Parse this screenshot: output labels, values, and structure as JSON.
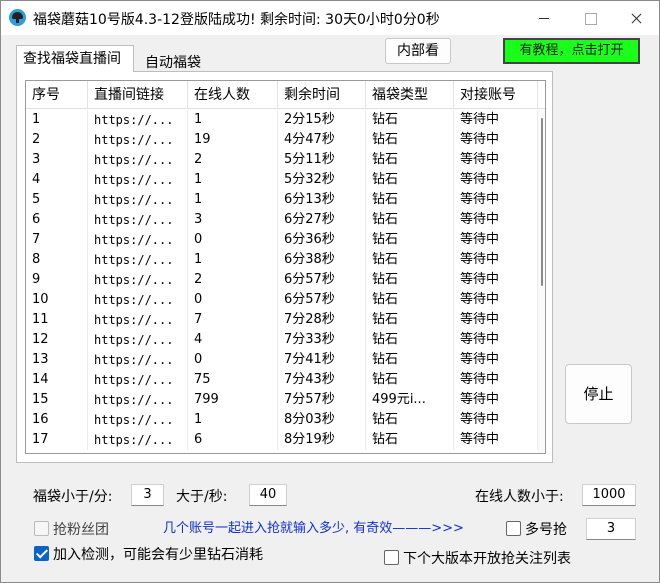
{
  "window": {
    "title": "福袋蘑菇10号版4.3-12登版陆成功! 剩余时间:  30天0小时0分0秒"
  },
  "tabs": {
    "find": "查找福袋直播间",
    "auto": "自动福袋"
  },
  "buttons": {
    "inner": "内部看",
    "tutorial": "有教程，点击打开",
    "stop": "停止"
  },
  "table": {
    "columns": [
      "序号",
      "直播间链接",
      "在线人数",
      "剩余时间",
      "福袋类型",
      "对接账号"
    ],
    "rows": [
      [
        "1",
        "https://...",
        "1",
        "2分15秒",
        "钻石",
        "等待中"
      ],
      [
        "2",
        "https://...",
        "19",
        "4分47秒",
        "钻石",
        "等待中"
      ],
      [
        "3",
        "https://...",
        "2",
        "5分11秒",
        "钻石",
        "等待中"
      ],
      [
        "4",
        "https://...",
        "1",
        "5分32秒",
        "钻石",
        "等待中"
      ],
      [
        "5",
        "https://...",
        "1",
        "6分13秒",
        "钻石",
        "等待中"
      ],
      [
        "6",
        "https://...",
        "3",
        "6分27秒",
        "钻石",
        "等待中"
      ],
      [
        "7",
        "https://...",
        "0",
        "6分36秒",
        "钻石",
        "等待中"
      ],
      [
        "8",
        "https://...",
        "1",
        "6分38秒",
        "钻石",
        "等待中"
      ],
      [
        "9",
        "https://...",
        "2",
        "6分57秒",
        "钻石",
        "等待中"
      ],
      [
        "10",
        "https://...",
        "0",
        "6分57秒",
        "钻石",
        "等待中"
      ],
      [
        "11",
        "https://...",
        "7",
        "7分28秒",
        "钻石",
        "等待中"
      ],
      [
        "12",
        "https://...",
        "4",
        "7分33秒",
        "钻石",
        "等待中"
      ],
      [
        "13",
        "https://...",
        "0",
        "7分41秒",
        "钻石",
        "等待中"
      ],
      [
        "14",
        "https://...",
        "75",
        "7分43秒",
        "钻石",
        "等待中"
      ],
      [
        "15",
        "https://...",
        "799",
        "7分57秒",
        "499元i...",
        "等待中"
      ],
      [
        "16",
        "https://...",
        "1",
        "8分03秒",
        "钻石",
        "等待中"
      ],
      [
        "17",
        "https://...",
        "6",
        "8分19秒",
        "钻石",
        "等待中"
      ]
    ]
  },
  "filters": {
    "less_than_minutes_label": "福袋小于/分:",
    "less_than_minutes_value": "3",
    "greater_than_seconds_label": "大于/秒:",
    "greater_than_seconds_value": "40",
    "online_less_than_label": "在线人数小于:",
    "online_less_than_value": "1000"
  },
  "options": {
    "grab_fans_label": "抢粉丝团",
    "grab_fans_checked": false,
    "hint_text": "几个账号一起进入抢就输入多少, 有奇效———>>>",
    "multi_grab_label": "多号抢",
    "multi_grab_checked": false,
    "multi_grab_value": "3",
    "join_detect_label": "加入检测，可能会有少里钻石消耗",
    "join_detect_checked": true,
    "next_version_label": "下个大版本开放抢关注列表",
    "next_version_checked": false
  },
  "icons": {
    "app": "mushroom-app-icon",
    "minimize": "minimize-icon",
    "maximize": "maximize-icon",
    "close": "close-icon",
    "checkmark": "checkmark-icon"
  },
  "colors": {
    "tutorial_bg": "#1aff1a",
    "hint_text": "#1030d0",
    "checkbox_checked": "#0a64c8"
  }
}
